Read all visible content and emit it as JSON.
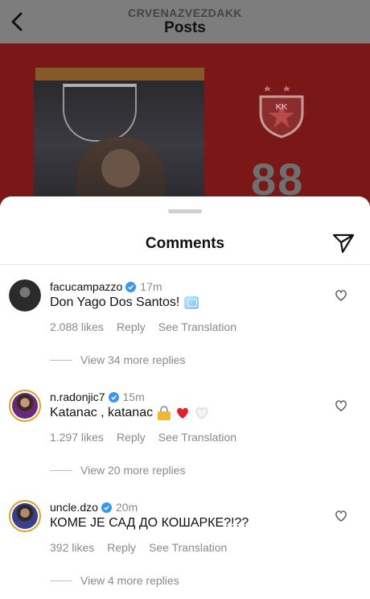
{
  "header": {
    "account": "CRVENAZVEZDAKK",
    "title": "Posts"
  },
  "post_graphic": {
    "number": "88",
    "crest": "KK"
  },
  "sheet": {
    "title": "Comments"
  },
  "comments": [
    {
      "username": "facucampazzo",
      "time": "17m",
      "text": "Don Yago Dos Santos!",
      "emoji": [
        "ice-cube-icon"
      ],
      "likes": "2.088 likes",
      "reply": "Reply",
      "translate": "See Translation",
      "view_replies": "View 34 more replies"
    },
    {
      "username": "n.radonjic7",
      "time": "15m",
      "text": "Katanac , katanac",
      "emoji": [
        "lock-icon",
        "red-heart-icon",
        "white-heart-icon"
      ],
      "likes": "1.297 likes",
      "reply": "Reply",
      "translate": "See Translation",
      "view_replies": "View 20 more replies"
    },
    {
      "username": "uncle.dzo",
      "time": "20m",
      "text": "КОМЕ ЈЕ САД ДО КОШАРКЕ?!??",
      "emoji": [],
      "likes": "392 likes",
      "reply": "Reply",
      "translate": "See Translation",
      "view_replies": "View 4 more replies"
    }
  ],
  "colors": {
    "verified": "#3897f0",
    "muted_text": "#8a8a8a",
    "story_ring": "#d9a12e"
  }
}
